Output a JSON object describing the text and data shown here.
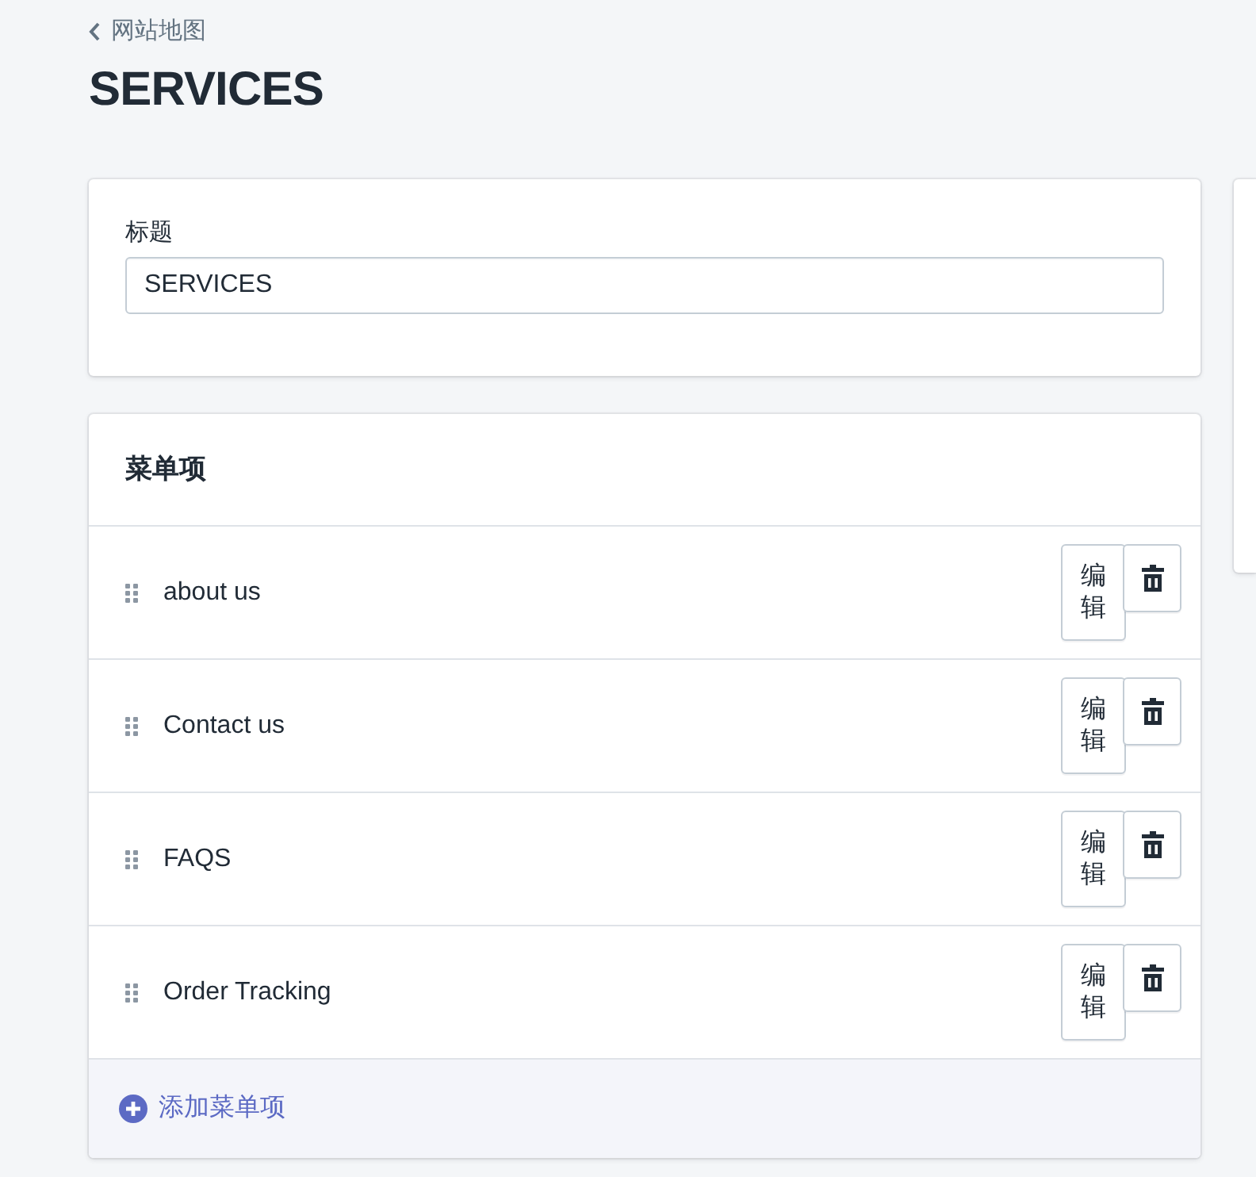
{
  "breadcrumb": {
    "label": "网站地图"
  },
  "page_title": "SERVICES",
  "title_card": {
    "label": "标题",
    "value": "SERVICES"
  },
  "menu_card": {
    "heading": "菜单项",
    "items": [
      {
        "label": "about us",
        "edit_button": "编辑"
      },
      {
        "label": "Contact us",
        "edit_button": "编辑"
      },
      {
        "label": "FAQS",
        "edit_button": "编辑"
      },
      {
        "label": "Order Tracking",
        "edit_button": "编辑"
      }
    ],
    "add_label": "添加菜单项"
  }
}
